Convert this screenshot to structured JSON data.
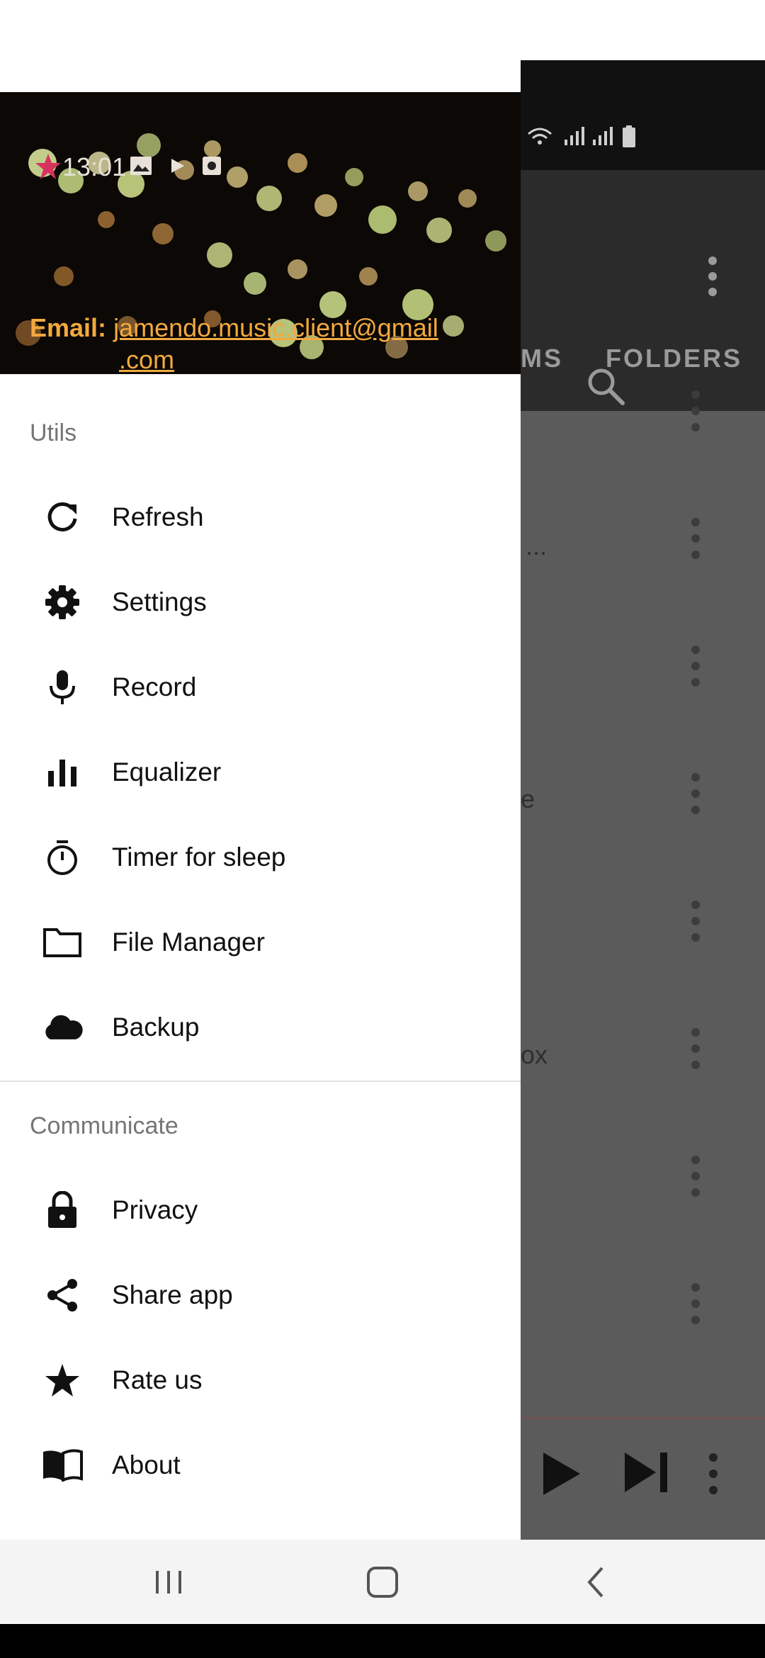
{
  "status_bar": {
    "time": "13:01"
  },
  "drawer": {
    "email_label": "Email:",
    "email_line1": "jamendo.music.client@gmail",
    "email_line2": ".com",
    "sections": {
      "utils_title": "Utils",
      "communicate_title": "Communicate"
    },
    "utils_items": [
      {
        "label": "Refresh",
        "icon": "refresh-icon"
      },
      {
        "label": "Settings",
        "icon": "gear-icon"
      },
      {
        "label": "Record",
        "icon": "microphone-icon"
      },
      {
        "label": "Equalizer",
        "icon": "equalizer-icon"
      },
      {
        "label": "Timer for sleep",
        "icon": "timer-icon"
      },
      {
        "label": "File Manager",
        "icon": "folder-icon"
      },
      {
        "label": "Backup",
        "icon": "cloud-icon"
      }
    ],
    "communicate_items": [
      {
        "label": "Privacy",
        "icon": "lock-icon"
      },
      {
        "label": "Share app",
        "icon": "share-icon"
      },
      {
        "label": "Rate us",
        "icon": "star-icon"
      },
      {
        "label": "About",
        "icon": "book-icon"
      }
    ]
  },
  "background_app": {
    "tabs": [
      "MS",
      "FOLDERS"
    ],
    "fragments": [
      "...",
      "e",
      "ox"
    ]
  },
  "colors": {
    "email_accent": "#f2a93e",
    "scrim": "#5b5b5b",
    "section_title": "#757575"
  }
}
